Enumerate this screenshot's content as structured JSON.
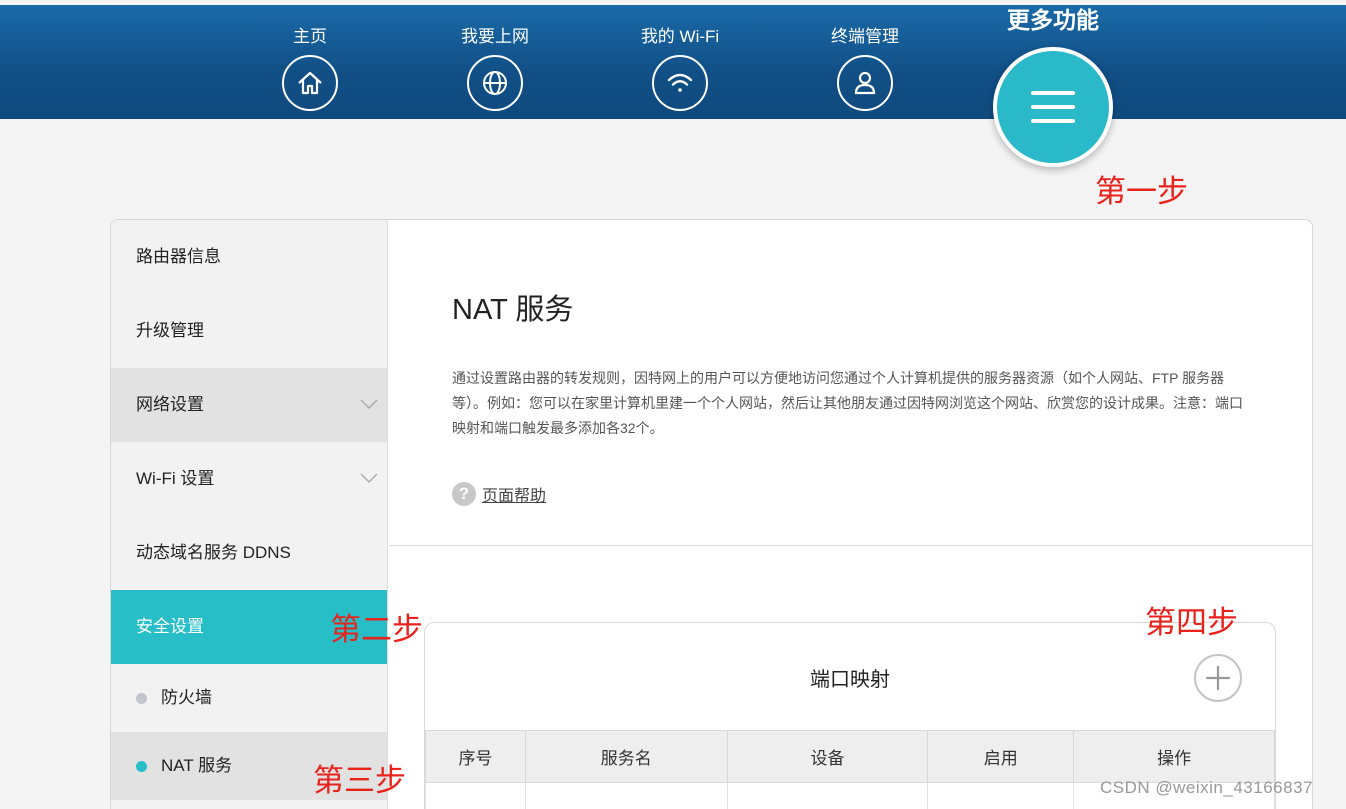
{
  "nav": {
    "items": [
      {
        "label": "主页",
        "icon": "home-icon"
      },
      {
        "label": "我要上网",
        "icon": "globe-icon"
      },
      {
        "label": "我的 Wi-Fi",
        "icon": "wifi-icon"
      },
      {
        "label": "终端管理",
        "icon": "user-icon"
      }
    ],
    "more_label": "更多功能",
    "more_icon": "menu-icon"
  },
  "annotations": {
    "step1": "第一步",
    "step2": "第二步",
    "step3": "第三步",
    "step4": "第四步"
  },
  "sidebar": {
    "items": [
      {
        "label": "路由器信息"
      },
      {
        "label": "升级管理"
      },
      {
        "label": "网络设置"
      },
      {
        "label": "Wi-Fi 设置"
      },
      {
        "label": "动态域名服务 DDNS"
      },
      {
        "label": "安全设置"
      }
    ],
    "sub_items": [
      {
        "label": "防火墙"
      },
      {
        "label": "NAT 服务"
      }
    ]
  },
  "main": {
    "title": "NAT 服务",
    "description": "通过设置路由器的转发规则，因特网上的用户可以方便地访问您通过个人计算机提供的服务器资源（如个人网站、FTP 服务器等）。例如：您可以在家里计算机里建一个个人网站，然后让其他朋友通过因特网浏览这个网站、欣赏您的设计成果。注意：端口映射和端口触发最多添加各32个。",
    "help_label": "页面帮助"
  },
  "port_mapping": {
    "title": "端口映射",
    "columns": [
      "序号",
      "服务名",
      "设备",
      "启用",
      "操作"
    ]
  },
  "colors": {
    "nav_bg": "#114f86",
    "accent": "#28bec8",
    "annotation": "#e8231c"
  },
  "watermark": "CSDN @weixin_43166837"
}
